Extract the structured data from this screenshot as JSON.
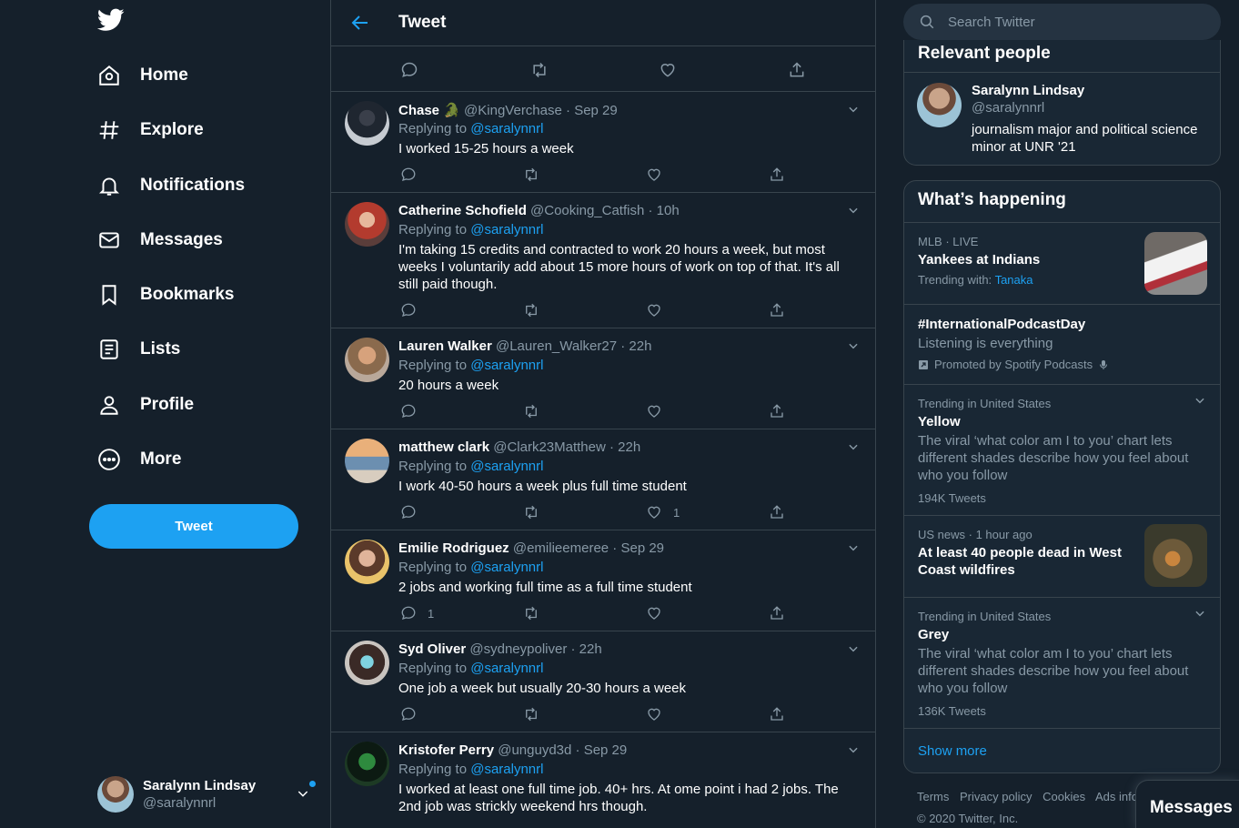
{
  "colors": {
    "accent": "#1da1f2",
    "background": "#15202b",
    "card": "#192734",
    "border": "#38444d",
    "muted": "#8899a6",
    "like": "#e0245e"
  },
  "nav": {
    "items": [
      {
        "label": "Home",
        "icon": "home-icon"
      },
      {
        "label": "Explore",
        "icon": "hashtag-icon"
      },
      {
        "label": "Notifications",
        "icon": "bell-icon"
      },
      {
        "label": "Messages",
        "icon": "envelope-icon"
      },
      {
        "label": "Bookmarks",
        "icon": "bookmark-icon"
      },
      {
        "label": "Lists",
        "icon": "list-icon"
      },
      {
        "label": "Profile",
        "icon": "person-icon"
      },
      {
        "label": "More",
        "icon": "more-circle-icon"
      }
    ],
    "tweet_button": "Tweet",
    "account": {
      "name": "Saralynn Lindsay",
      "handle": "@saralynnrl"
    }
  },
  "main": {
    "title": "Tweet",
    "replies": [
      {
        "name": "Chase 🐊",
        "handle": "@KingVerchase",
        "time": "Sep 29",
        "replying_label": "Replying to",
        "replying_to": "@saralynnrl",
        "text": "I worked 15-25 hours a week",
        "reply_count": "",
        "like_count": ""
      },
      {
        "name": "Catherine Schofield",
        "handle": "@Cooking_Catfish",
        "time": "10h",
        "replying_label": "Replying to",
        "replying_to": "@saralynnrl",
        "text": "I'm taking 15 credits and contracted to work 20 hours a week, but most weeks I voluntarily add about 15 more hours of work on top of that. It's all still paid though.",
        "reply_count": "",
        "like_count": ""
      },
      {
        "name": "Lauren Walker",
        "handle": "@Lauren_Walker27",
        "time": "22h",
        "replying_label": "Replying to",
        "replying_to": "@saralynnrl",
        "text": "20 hours a week",
        "reply_count": "",
        "like_count": ""
      },
      {
        "name": "matthew clark",
        "handle": "@Clark23Matthew",
        "time": "22h",
        "replying_label": "Replying to",
        "replying_to": "@saralynnrl",
        "text": "I work 40-50 hours a week plus full time student",
        "reply_count": "",
        "like_count": "1"
      },
      {
        "name": "Emilie Rodriguez",
        "handle": "@emilieemeree",
        "time": "Sep 29",
        "replying_label": "Replying to",
        "replying_to": "@saralynnrl",
        "text": "2 jobs and working full time as a full time student",
        "reply_count": "1",
        "like_count": ""
      },
      {
        "name": "Syd Oliver",
        "handle": "@sydneypoliver",
        "time": "22h",
        "replying_label": "Replying to",
        "replying_to": "@saralynnrl",
        "text": "One job a week but usually 20-30 hours a week",
        "reply_count": "",
        "like_count": ""
      },
      {
        "name": "Kristofer Perry",
        "handle": "@unguyd3d",
        "time": "Sep 29",
        "replying_label": "Replying to",
        "replying_to": "@saralynnrl",
        "text": "I worked at least one full time job. 40+ hrs. At ome point i had 2 jobs. The 2nd job was strickly weekend hrs though.",
        "reply_count": "",
        "like_count": ""
      }
    ]
  },
  "right": {
    "search_placeholder": "Search Twitter",
    "relevant": {
      "title": "Relevant people",
      "name": "Saralynn Lindsay",
      "handle": "@saralynnrl",
      "bio": "journalism major and political science minor at UNR '21"
    },
    "happening": {
      "title": "What’s happening",
      "trends": [
        {
          "context": "MLB · LIVE",
          "title": "Yankees at Indians",
          "sub_label": "Trending with:",
          "sub_link": "Tanaka"
        },
        {
          "context": "",
          "title": "#InternationalPodcastDay",
          "desc": "Listening is everything",
          "promoted": "Promoted by Spotify Podcasts"
        },
        {
          "context": "Trending in United States",
          "title": "Yellow",
          "desc": "The viral ‘what color am I to you’ chart lets different shades describe how you feel about who you follow",
          "count": "194K Tweets"
        },
        {
          "context": "US news · 1 hour ago",
          "title": "At least 40 people dead in West Coast wildfires"
        },
        {
          "context": "Trending in United States",
          "title": "Grey",
          "desc": "The viral ‘what color am I to you’ chart lets different shades describe how you feel about who you follow",
          "count": "136K Tweets"
        }
      ],
      "show_more": "Show more"
    },
    "footer": {
      "links": [
        "Terms",
        "Privacy policy",
        "Cookies",
        "Ads info"
      ],
      "copyright": "© 2020 Twitter, Inc."
    },
    "messages_drawer": "Messages"
  }
}
